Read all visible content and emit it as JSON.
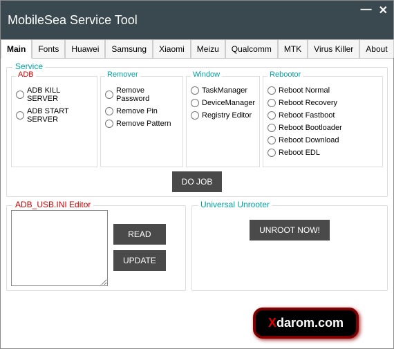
{
  "window": {
    "title": "MobileSea Service Tool"
  },
  "tabs": [
    "Main",
    "Fonts",
    "Huawei",
    "Samsung",
    "Xiaomi",
    "Meizu",
    "Qualcomm",
    "MTK",
    "Virus Killer",
    "About"
  ],
  "service": {
    "title": "Service",
    "adb": {
      "title": "ADB",
      "items": [
        "ADB KILL SERVER",
        "ADB START SERVER"
      ]
    },
    "remover": {
      "title": "Remover",
      "items": [
        "Remove Password",
        "Remove Pin",
        "Remove Pattern"
      ]
    },
    "windowg": {
      "title": "Window",
      "items": [
        "TaskManager",
        "DeviceManager",
        "Registry Editor"
      ]
    },
    "rebootor": {
      "title": "Rebootor",
      "items": [
        "Reboot Normal",
        "Reboot Recovery",
        "Reboot Fastboot",
        "Reboot Bootloader",
        "Reboot Download",
        "Reboot EDL"
      ]
    },
    "do_job": "DO JOB"
  },
  "editor": {
    "title": "ADB_USB.INI Editor",
    "read": "READ",
    "update": "UPDATE"
  },
  "unrooter": {
    "title": "Universal Unrooter",
    "btn": "UNROOT NOW!"
  },
  "watermark": "darom.com"
}
